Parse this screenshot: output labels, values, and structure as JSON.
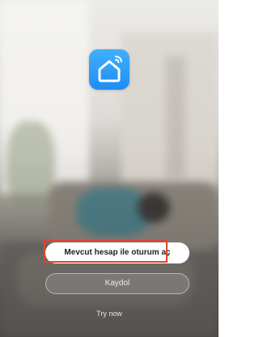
{
  "login": {
    "existing_account_label": "Mevcut hesap ile oturum aç",
    "register_label": "Kaydol",
    "try_now_label": "Try now"
  },
  "colors": {
    "logo_blue": "#2196f3",
    "highlight_red": "#e0442f",
    "button_white": "#ffffff"
  },
  "icons": {
    "logo": "smart-home-icon"
  }
}
